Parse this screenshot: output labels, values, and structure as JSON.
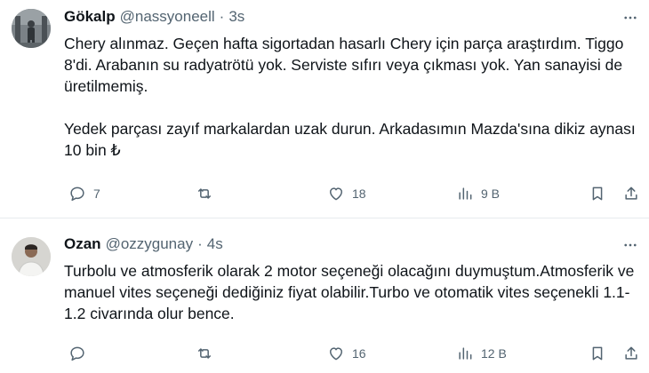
{
  "tweets": [
    {
      "display_name": "Gökalp",
      "handle": "@nassyoneell",
      "separator": "·",
      "time": "3s",
      "paragraphs": [
        "Chery alınmaz. Geçen hafta sigortadan hasarlı Chery için parça araştırdım. Tiggo 8'di. Arabanın su radyatrötü yok. Serviste sıfırı veya çıkması yok. Yan sanayisi de üretilmemiş.",
        "Yedek parçası zayıf markalardan uzak durun. Arkadasımın Mazda'sına dikiz aynası 10 bin ₺"
      ],
      "replies": "7",
      "retweets": "",
      "likes": "18",
      "views": "9 B"
    },
    {
      "display_name": "Ozan",
      "handle": "@ozzygunay",
      "separator": "·",
      "time": "4s",
      "paragraphs": [
        "Turbolu ve atmosferik olarak 2 motor seçeneği olacağını duymuştum.Atmosferik ve manuel vites seçeneği dediğiniz fiyat olabilir.Turbo ve otomatik vites seçenekli 1.1-1.2 civarında olur bence."
      ],
      "replies": "",
      "retweets": "",
      "likes": "16",
      "views": "12 B"
    }
  ],
  "icons": {
    "more": "more-horizontal-icon",
    "reply": "reply-icon",
    "retweet": "retweet-icon",
    "like": "heart-icon",
    "views": "views-chart-icon",
    "bookmark": "bookmark-icon",
    "share": "share-icon"
  },
  "colors": {
    "text": "#0f1419",
    "secondary": "#536471",
    "divider": "#e7ebee"
  }
}
